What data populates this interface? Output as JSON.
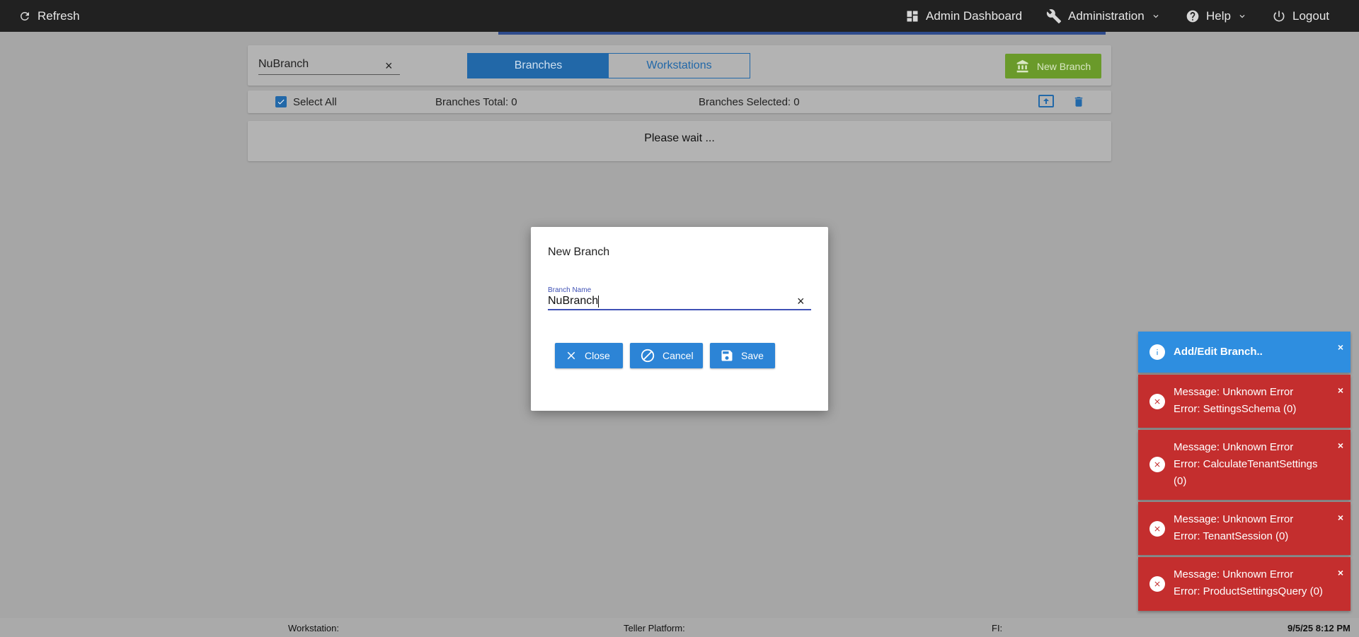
{
  "topbar": {
    "refresh_label": "Refresh",
    "admin_dashboard_label": "Admin Dashboard",
    "administration_label": "Administration",
    "help_label": "Help",
    "logout_label": "Logout"
  },
  "search": {
    "value": "NuBranch",
    "clear": "×"
  },
  "tabs": [
    {
      "label": "Branches",
      "active": true
    },
    {
      "label": "Workstations",
      "active": false
    }
  ],
  "new_branch_label": "New Branch",
  "list_header": {
    "select_all": "Select All",
    "total": "Branches Total: 0",
    "selected": "Branches Selected: 0"
  },
  "wait_text": "Please wait ...",
  "dialog": {
    "title": "New Branch",
    "field_label": "Branch Name",
    "field_value": "NuBranch",
    "clear": "×",
    "close_label": "Close",
    "cancel_label": "Cancel",
    "save_label": "Save"
  },
  "toasts": [
    {
      "type": "info",
      "lines": [
        "Add/Edit Branch.."
      ]
    },
    {
      "type": "error",
      "lines": [
        "Message: Unknown Error",
        "Error: SettingsSchema (0)"
      ]
    },
    {
      "type": "error",
      "lines": [
        "Message: Unknown Error",
        "Error: CalculateTenantSettings",
        "(0)"
      ]
    },
    {
      "type": "error",
      "lines": [
        "Message: Unknown Error",
        "Error: TenantSession (0)"
      ]
    },
    {
      "type": "error",
      "lines": [
        "Message: Unknown Error",
        "Error: ProductSettingsQuery (0)"
      ]
    }
  ],
  "toast_close": "×",
  "statusbar": {
    "workstation": "Workstation:",
    "teller_platform": "Teller Platform:",
    "fi": "FI:",
    "datetime": "9/5/25 8:12 PM"
  },
  "colors": {
    "topbar": "#212121",
    "primary": "#2268a8",
    "button": "#2c84d6",
    "success": "#6a9a2a",
    "error": "#c42e2e",
    "info": "#2e8ee0"
  }
}
